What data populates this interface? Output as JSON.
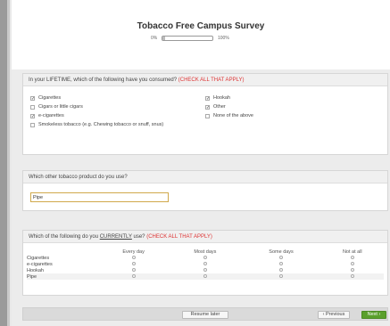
{
  "survey": {
    "title": "Tobacco Free Campus Survey",
    "progress": {
      "start_label": "0%",
      "end_label": "100%",
      "fraction": 0.05
    }
  },
  "q1": {
    "prompt": "In your LIFETIME, which of the following have you consumed?",
    "instruction": "(CHECK ALL THAT APPLY)",
    "options_left": [
      {
        "label": "Cigarettes",
        "checked": true
      },
      {
        "label": "Cigars or little cigars",
        "checked": false
      },
      {
        "label": "e-cigarettes",
        "checked": true
      },
      {
        "label": "Smokeless tobacco (e.g. Chewing tobacco or snuff, snus)",
        "checked": false
      }
    ],
    "options_right": [
      {
        "label": "Hookah",
        "checked": true
      },
      {
        "label": "Other",
        "checked": true
      },
      {
        "label": "None of the above",
        "checked": false
      }
    ]
  },
  "q2": {
    "prompt": "Which other tobacco product do you use?",
    "value": "Pipe"
  },
  "q3": {
    "prompt_pre": "Which of the following do you ",
    "prompt_emph": "CURRENTLY",
    "prompt_post": " use?",
    "instruction": "(CHECK ALL THAT APPLY)",
    "columns": [
      "Every day",
      "Most days",
      "Some days",
      "Not at all"
    ],
    "rows": [
      "Cigarettes",
      "e-cigarettes",
      "Hookah",
      "Pipe"
    ]
  },
  "footer": {
    "resume_label": "Resume later",
    "previous_label": "‹ Previous",
    "next_label": "Next ›"
  }
}
